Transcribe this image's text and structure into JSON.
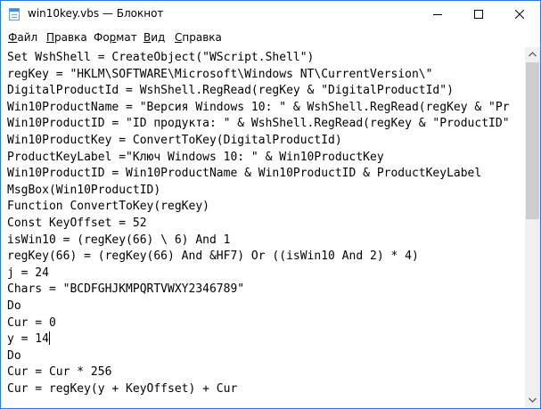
{
  "window": {
    "title": "win10key.vbs — Блокнот",
    "icon": "notepad-icon"
  },
  "caption_buttons": {
    "minimize": "minimize-icon",
    "maximize": "maximize-icon",
    "close": "close-icon"
  },
  "menu": {
    "file": {
      "acc": "Ф",
      "rest": "айл"
    },
    "edit": {
      "acc": "П",
      "rest": "равка"
    },
    "format": {
      "pre": "Фо",
      "acc": "р",
      "rest": "мат"
    },
    "view": {
      "acc": "В",
      "rest": "ид"
    },
    "help": {
      "acc": "С",
      "rest": "правка"
    }
  },
  "editor": {
    "lines": [
      "Set WshShell = CreateObject(\"WScript.Shell\")",
      "regKey = \"HKLM\\SOFTWARE\\Microsoft\\Windows NT\\CurrentVersion\\\"",
      "DigitalProductId = WshShell.RegRead(regKey & \"DigitalProductId\")",
      "Win10ProductName = \"Версия Windows 10: \" & WshShell.RegRead(regKey & \"Pr",
      "Win10ProductID = \"ID продукта: \" & WshShell.RegRead(regKey & \"ProductID\"",
      "Win10ProductKey = ConvertToKey(DigitalProductId)",
      "ProductKeyLabel =\"Ключ Windows 10: \" & Win10ProductKey",
      "Win10ProductID = Win10ProductName & Win10ProductID & ProductKeyLabel",
      "MsgBox(Win10ProductID)",
      "Function ConvertToKey(regKey)",
      "Const KeyOffset = 52",
      "isWin10 = (regKey(66) \\ 6) And 1",
      "regKey(66) = (regKey(66) And &HF7) Or ((isWin10 And 2) * 4)",
      "j = 24",
      "Chars = \"BCDFGHJKMPQRTVWXY2346789\"",
      "Do",
      "Cur = 0",
      "y = 14",
      "Do",
      "Cur = Cur * 256",
      "Cur = regKey(y + KeyOffset) + Cur"
    ],
    "caret_line": 17
  },
  "scrollbar": {
    "up": "scroll-up-arrow-icon",
    "down": "scroll-down-arrow-icon",
    "position": 0
  }
}
